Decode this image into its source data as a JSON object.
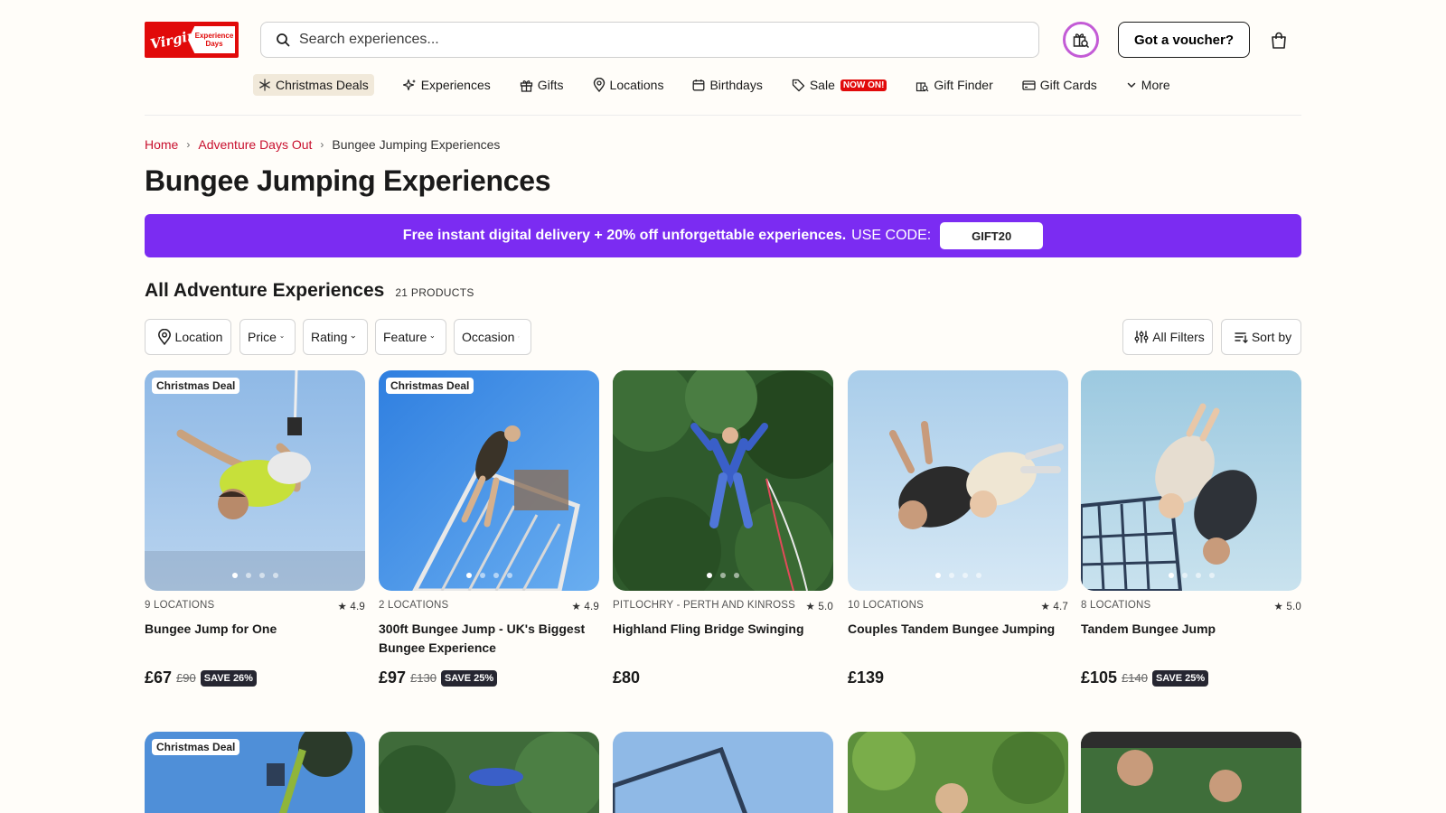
{
  "brand": {
    "logo_script": "Virgin",
    "logo_badge": "Experience Days"
  },
  "header": {
    "search_placeholder": "Search experiences...",
    "voucher_label": "Got a voucher?"
  },
  "nav": {
    "christmas": "Christmas Deals",
    "experiences": "Experiences",
    "gifts": "Gifts",
    "locations": "Locations",
    "birthdays": "Birthdays",
    "sale": "Sale",
    "sale_badge": "NOW ON!",
    "gift_finder": "Gift Finder",
    "gift_cards": "Gift Cards",
    "more": "More"
  },
  "breadcrumb": {
    "home": "Home",
    "parent": "Adventure Days Out",
    "current": "Bungee Jumping Experiences"
  },
  "page_title": "Bungee Jumping Experiences",
  "promo": {
    "text": "Free instant digital delivery + 20% off unforgettable experiences.",
    "code_label": "USE CODE:",
    "code": "GIFT20"
  },
  "section": {
    "title": "All Adventure Experiences",
    "count": "21 PRODUCTS"
  },
  "filters": {
    "location": "Location",
    "price": "Price",
    "rating": "Rating",
    "feature": "Feature",
    "occasion": "Occasion",
    "all_filters": "All Filters",
    "sort_by": "Sort by"
  },
  "colors": {
    "accent_red": "#c8102e",
    "promo_purple": "#7b2cf2",
    "save_badge": "#262631"
  },
  "products": [
    {
      "tag": "Christmas Deal",
      "locations": "9 LOCATIONS",
      "rating": "4.9",
      "name": "Bungee Jump for One",
      "price": "£67",
      "old_price": "£90",
      "save": "SAVE 26%"
    },
    {
      "tag": "Christmas Deal",
      "locations": "2 LOCATIONS",
      "rating": "4.9",
      "name": "300ft Bungee Jump - UK's Biggest Bungee Experience",
      "price": "£97",
      "old_price": "£130",
      "save": "SAVE 25%"
    },
    {
      "tag": "",
      "locations": "PITLOCHRY - PERTH AND KINROSS",
      "rating": "5.0",
      "name": "Highland Fling Bridge Swinging",
      "price": "£80",
      "old_price": "",
      "save": ""
    },
    {
      "tag": "",
      "locations": "10 LOCATIONS",
      "rating": "4.7",
      "name": "Couples Tandem Bungee Jumping",
      "price": "£139",
      "old_price": "",
      "save": ""
    },
    {
      "tag": "",
      "locations": "8 LOCATIONS",
      "rating": "5.0",
      "name": "Tandem Bungee Jump",
      "price": "£105",
      "old_price": "£140",
      "save": "SAVE 25%"
    }
  ],
  "row2": [
    {
      "tag": "Christmas Deal"
    }
  ]
}
